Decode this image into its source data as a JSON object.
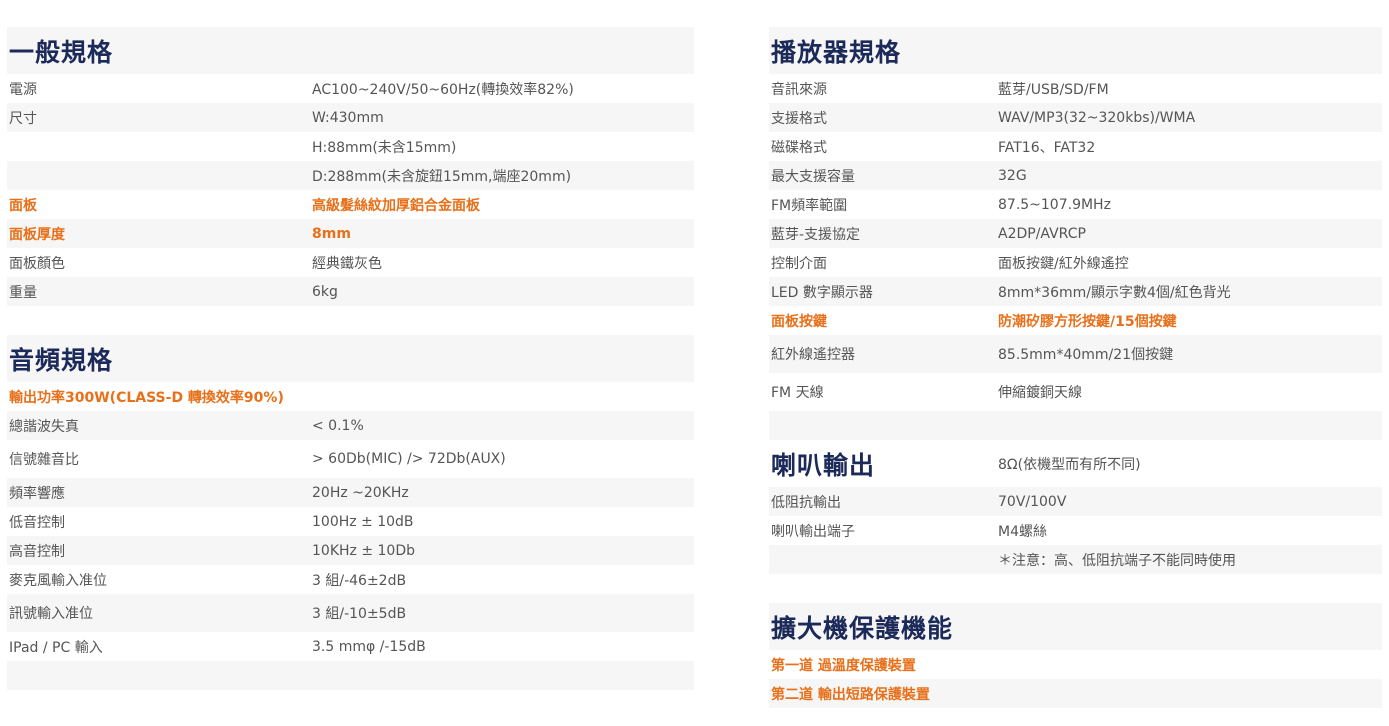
{
  "general": {
    "title": "一般規格",
    "rows": [
      {
        "label": "電源",
        "value": "AC100~240V/50~60Hz(轉換效率82%)"
      },
      {
        "label": "尺寸",
        "value": "W:430mm"
      },
      {
        "label": "",
        "value": "H:88mm(未含15mm)"
      },
      {
        "label": "",
        "value": "D:288mm(未含旋鈕15mm,端座20mm)"
      },
      {
        "label": "面板",
        "value": "高級髮絲紋加厚鋁合金面板"
      },
      {
        "label": "面板厚度",
        "value": "8mm"
      },
      {
        "label": "面板顏色",
        "value": "經典鐵灰色"
      },
      {
        "label": "重量",
        "value": "6kg"
      }
    ]
  },
  "audio": {
    "title": "音頻規格",
    "highlight": "輸出功率300W(CLASS-D 轉換效率90%)",
    "rows": [
      {
        "label": "總諧波失真",
        "value": "< 0.1%"
      },
      {
        "label": "信號雜音比",
        "value": "> 60Db(MIC) /> 72Db(AUX)"
      },
      {
        "label": "頻率響應",
        "value": "20Hz ~20KHz"
      },
      {
        "label": "低音控制",
        "value": "100Hz ± 10dB"
      },
      {
        "label": "高音控制",
        "value": "10KHz ± 10Db"
      },
      {
        "label": "麥克風輸入准位",
        "value": "3 組/-46±2dB"
      },
      {
        "label": "訊號輸入准位",
        "value": "3 組/-10±5dB"
      },
      {
        "label": "IPad / PC 輸入",
        "value": "3.5 mmφ /-15dB"
      }
    ]
  },
  "player": {
    "title": "播放器規格",
    "rows": [
      {
        "label": "音訊來源",
        "value": "藍芽/USB/SD/FM"
      },
      {
        "label": "支援格式",
        "value": "WAV/MP3(32~320kbs)/WMA"
      },
      {
        "label": "磁碟格式",
        "value": "FAT16、FAT32"
      },
      {
        "label": "最大支援容量",
        "value": "32G"
      },
      {
        "label": "FM頻率範圍",
        "value": "87.5~107.9MHz"
      },
      {
        "label": "藍芽-支援協定",
        "value": "A2DP/AVRCP"
      },
      {
        "label": "控制介面",
        "value": "面板按鍵/紅外線遙控"
      },
      {
        "label": "LED 數字顯示器",
        "value": "8mm*36mm/顯示字數4個/紅色背光"
      },
      {
        "label": "面板按鍵",
        "value": "防潮矽膠方形按鍵/15個按鍵"
      },
      {
        "label": "紅外線遙控器",
        "value": "85.5mm*40mm/21個按鍵"
      },
      {
        "label": "FM 天線",
        "value": "伸縮鍍銅天線"
      }
    ]
  },
  "speaker": {
    "title": "喇叭輸出",
    "title_value": "8Ω(依機型而有所不同)",
    "rows": [
      {
        "label": "低阻抗輸出",
        "value": "70V/100V"
      },
      {
        "label": "喇叭輸出端子",
        "value": "M4螺絲"
      },
      {
        "label": "",
        "value": "＊注意：高、低阻抗端子不能同時使用"
      }
    ]
  },
  "protection": {
    "title": "擴大機保護機能",
    "items": [
      "第一道 過溫度保護裝置",
      "第二道 輸出短路保護裝置"
    ]
  },
  "colors": {
    "heading": "#1c2a5a",
    "highlight": "#e8701a",
    "stripe": "#f6f6f6",
    "text": "#555555"
  }
}
